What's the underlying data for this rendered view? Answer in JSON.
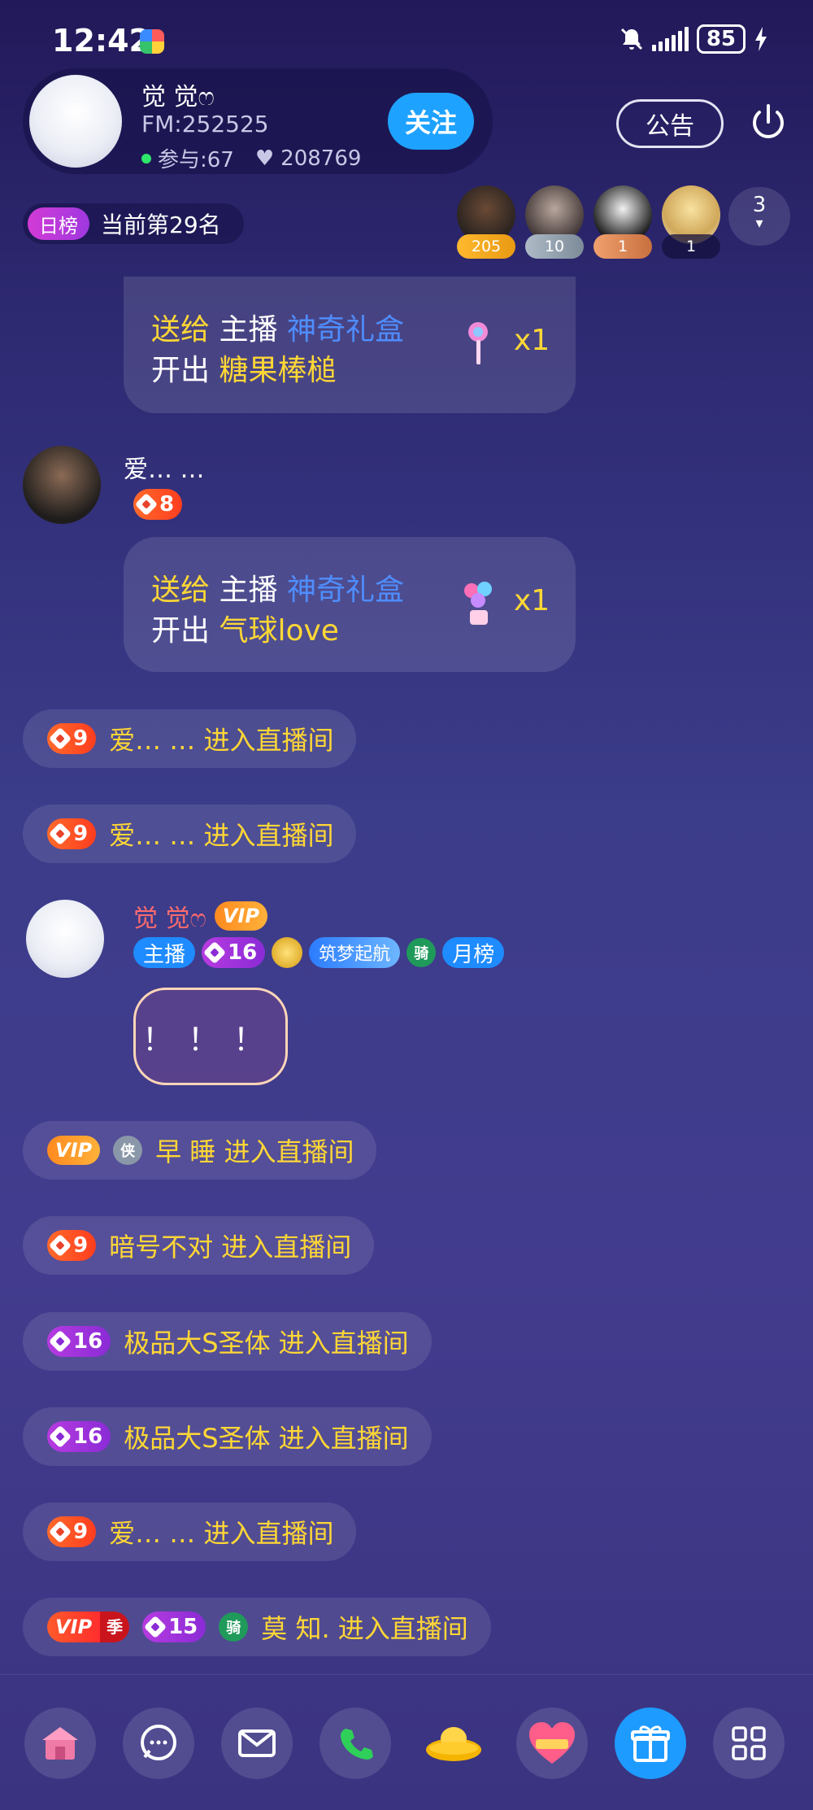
{
  "status": {
    "time": "12:42",
    "battery": "85"
  },
  "host": {
    "name": "觉 觉ෆ",
    "fm": "FM:252525",
    "participants": "参与:67",
    "likes": "208769",
    "follow_label": "关注"
  },
  "header": {
    "notice_label": "公告"
  },
  "rank": {
    "tag": "日榜",
    "text": "当前第29名"
  },
  "viewers": [
    {
      "badge": "205"
    },
    {
      "badge": "10"
    },
    {
      "badge": "1"
    },
    {
      "badge": "1"
    }
  ],
  "viewer_count": "3",
  "chat": {
    "gift1": {
      "prefix": "送给",
      "target": "主播",
      "gift": "神奇礼盒",
      "open": "开出",
      "result": "糖果棒槌",
      "qty": "x1"
    },
    "user1": {
      "name": "爱… …",
      "level": "8"
    },
    "gift2": {
      "prefix": "送给",
      "target": "主播",
      "gift": "神奇礼盒",
      "open": "开出",
      "result": "气球love",
      "qty": "x1"
    },
    "sys1": {
      "level": "9",
      "text": "爱… … 进入直播间"
    },
    "sys2": {
      "level": "9",
      "text": "爱… … 进入直播间"
    },
    "host_msg": {
      "name": "觉 觉ෆ",
      "vip": "VIP",
      "tag_host": "主播",
      "level": "16",
      "tag_sky": "筑梦起航",
      "tag_ride": "骑",
      "tag_month": "月榜",
      "text": "！！！"
    },
    "sys3": {
      "vip": "VIP",
      "shield": "侠",
      "text": "早 睡 进入直播间"
    },
    "sys4": {
      "level": "9",
      "text": "暗号不对 进入直播间"
    },
    "sys5": {
      "level": "16",
      "text": "极品大S圣体 进入直播间"
    },
    "sys6": {
      "level": "16",
      "text": "极品大S圣体 进入直播间"
    },
    "sys7": {
      "level": "9",
      "text": "爱… … 进入直播间"
    },
    "sys8": {
      "vip": "VIP",
      "season": "季",
      "level": "15",
      "ride": "骑",
      "text": "莫 知. 进入直播间"
    }
  }
}
